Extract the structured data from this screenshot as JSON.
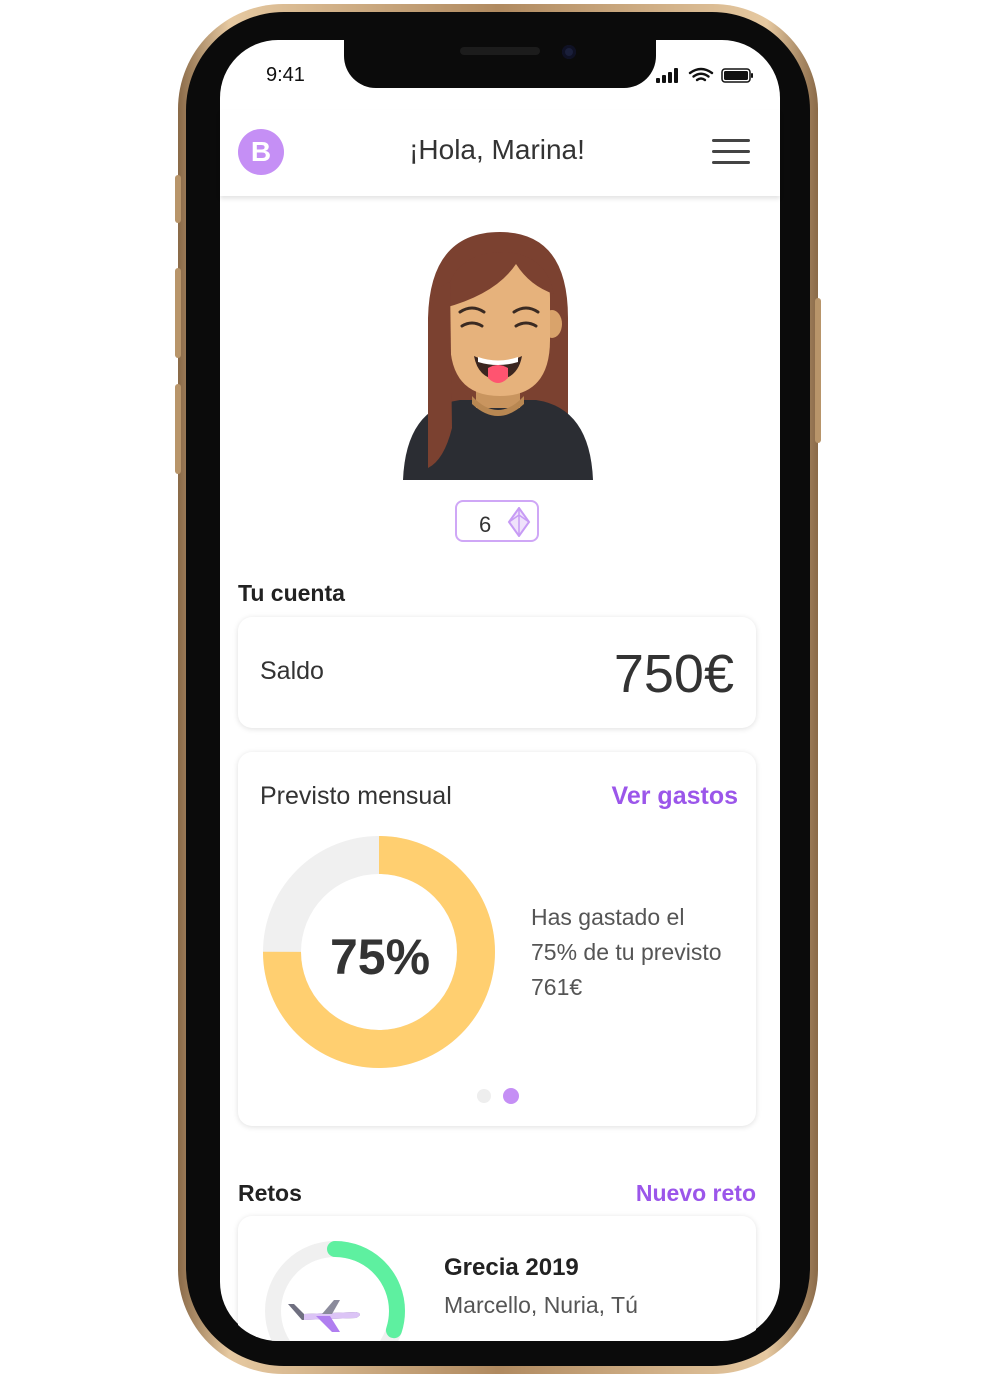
{
  "status_bar": {
    "time": "9:41"
  },
  "header": {
    "logo_letter": "B",
    "title": "¡Hola, Marina!"
  },
  "profile": {
    "gems": "6"
  },
  "account": {
    "section_title": "Tu cuenta",
    "balance_label": "Saldo",
    "balance_value": "750€"
  },
  "forecast": {
    "title": "Previsto mensual",
    "link_label": "Ver gastos",
    "percent_label": "75%",
    "percent_spent": 0.75,
    "description": "Has gastado el 75% de tu previsto 761€",
    "active_page": 2,
    "page_count": 2
  },
  "challenges": {
    "section_title": "Retos",
    "new_label": "Nuevo reto",
    "items": [
      {
        "title": "Grecia 2019",
        "participants": "Marcello, Nuria, Tú",
        "progress": 0.3
      }
    ]
  },
  "colors": {
    "accent": "#9b56ea",
    "logo": "#c58ff5",
    "donut_fill": "#ffcf70",
    "donut_track": "#f0f0f0",
    "challenge_progress": "#5ef0a0"
  }
}
